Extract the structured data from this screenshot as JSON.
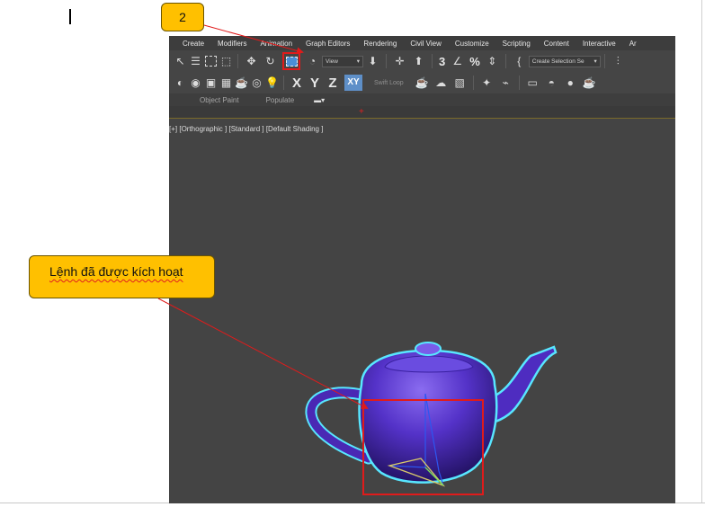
{
  "menubar": {
    "items": [
      "Create",
      "Modifiers",
      "Animation",
      "Graph Editors",
      "Rendering",
      "Civil View",
      "Customize",
      "Scripting",
      "Content",
      "Interactive",
      "Ar"
    ]
  },
  "toolbar_main": {
    "view_dropdown": "View",
    "selection_set_dropdown": "Create Selection Se",
    "snaps": [
      "3",
      "%"
    ]
  },
  "toolbar_axis": {
    "x": "X",
    "y": "Y",
    "z": "Z",
    "xy": "XY",
    "swift_loop": "Swift Loop"
  },
  "ribbon": {
    "tabs": [
      "Object Paint",
      "Populate"
    ]
  },
  "viewport": {
    "label": "[+] [Orthographic ] [Standard ] [Default Shading ]"
  },
  "annotations": {
    "step_number": "2",
    "message": "Lệnh đã được kích hoạt",
    "accent_color": "#ffc000",
    "highlight_color": "#e01b1b"
  },
  "scene": {
    "object": "teapot-icon",
    "object_color": "#5530c8",
    "selection_outline_color": "#58e6ff"
  }
}
